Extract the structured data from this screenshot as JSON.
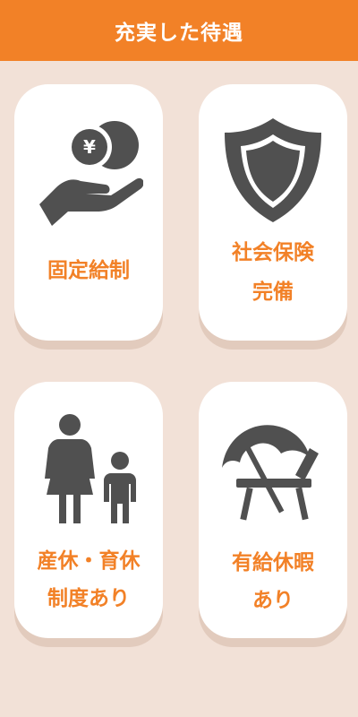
{
  "header": {
    "title": "充実した待遇"
  },
  "colors": {
    "accent": "#f28127",
    "background": "#f2e1d7",
    "card": "#ffffff",
    "icon": "#505050"
  },
  "cards": [
    {
      "icon": "hand-with-yen-coin-icon",
      "lines": [
        "固定給制"
      ]
    },
    {
      "icon": "shield-icon",
      "lines": [
        "社会保険",
        "完備"
      ]
    },
    {
      "icon": "mother-and-child-icon",
      "lines": [
        "産休・育休",
        "制度あり"
      ]
    },
    {
      "icon": "beach-parasol-chair-icon",
      "lines": [
        "有給休暇",
        "あり"
      ]
    }
  ]
}
